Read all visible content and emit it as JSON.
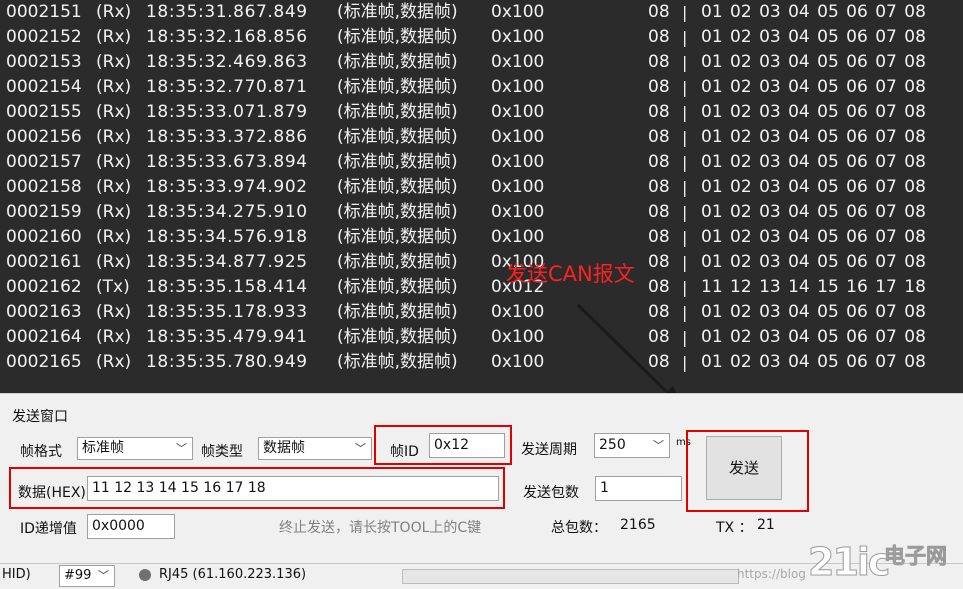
{
  "log": {
    "rows": [
      {
        "seq": "0002151",
        "dir": "(Rx)",
        "time": "18:35:31.867.849",
        "type": "(标准帧,数据帧)",
        "id": "0x100",
        "dlc": "08",
        "data": "01 02 03 04 05 06 07 08"
      },
      {
        "seq": "0002152",
        "dir": "(Rx)",
        "time": "18:35:32.168.856",
        "type": "(标准帧,数据帧)",
        "id": "0x100",
        "dlc": "08",
        "data": "01 02 03 04 05 06 07 08"
      },
      {
        "seq": "0002153",
        "dir": "(Rx)",
        "time": "18:35:32.469.863",
        "type": "(标准帧,数据帧)",
        "id": "0x100",
        "dlc": "08",
        "data": "01 02 03 04 05 06 07 08"
      },
      {
        "seq": "0002154",
        "dir": "(Rx)",
        "time": "18:35:32.770.871",
        "type": "(标准帧,数据帧)",
        "id": "0x100",
        "dlc": "08",
        "data": "01 02 03 04 05 06 07 08"
      },
      {
        "seq": "0002155",
        "dir": "(Rx)",
        "time": "18:35:33.071.879",
        "type": "(标准帧,数据帧)",
        "id": "0x100",
        "dlc": "08",
        "data": "01 02 03 04 05 06 07 08"
      },
      {
        "seq": "0002156",
        "dir": "(Rx)",
        "time": "18:35:33.372.886",
        "type": "(标准帧,数据帧)",
        "id": "0x100",
        "dlc": "08",
        "data": "01 02 03 04 05 06 07 08"
      },
      {
        "seq": "0002157",
        "dir": "(Rx)",
        "time": "18:35:33.673.894",
        "type": "(标准帧,数据帧)",
        "id": "0x100",
        "dlc": "08",
        "data": "01 02 03 04 05 06 07 08"
      },
      {
        "seq": "0002158",
        "dir": "(Rx)",
        "time": "18:35:33.974.902",
        "type": "(标准帧,数据帧)",
        "id": "0x100",
        "dlc": "08",
        "data": "01 02 03 04 05 06 07 08"
      },
      {
        "seq": "0002159",
        "dir": "(Rx)",
        "time": "18:35:34.275.910",
        "type": "(标准帧,数据帧)",
        "id": "0x100",
        "dlc": "08",
        "data": "01 02 03 04 05 06 07 08"
      },
      {
        "seq": "0002160",
        "dir": "(Rx)",
        "time": "18:35:34.576.918",
        "type": "(标准帧,数据帧)",
        "id": "0x100",
        "dlc": "08",
        "data": "01 02 03 04 05 06 07 08"
      },
      {
        "seq": "0002161",
        "dir": "(Rx)",
        "time": "18:35:34.877.925",
        "type": "(标准帧,数据帧)",
        "id": "0x100",
        "dlc": "08",
        "data": "01 02 03 04 05 06 07 08"
      },
      {
        "seq": "0002162",
        "dir": "(Tx)",
        "time": "18:35:35.158.414",
        "type": "(标准帧,数据帧)",
        "id": "0x012",
        "dlc": "08",
        "data": "11 12 13 14 15 16 17 18"
      },
      {
        "seq": "0002163",
        "dir": "(Rx)",
        "time": "18:35:35.178.933",
        "type": "(标准帧,数据帧)",
        "id": "0x100",
        "dlc": "08",
        "data": "01 02 03 04 05 06 07 08"
      },
      {
        "seq": "0002164",
        "dir": "(Rx)",
        "time": "18:35:35.479.941",
        "type": "(标准帧,数据帧)",
        "id": "0x100",
        "dlc": "08",
        "data": "01 02 03 04 05 06 07 08"
      },
      {
        "seq": "0002165",
        "dir": "(Rx)",
        "time": "18:35:35.780.949",
        "type": "(标准帧,数据帧)",
        "id": "0x100",
        "dlc": "08",
        "data": "01 02 03 04 05 06 07 08"
      }
    ],
    "separator": "|"
  },
  "annotation": {
    "text": "发送CAN报文",
    "color": "#ff2020"
  },
  "send_window": {
    "title": "发送窗口",
    "frame_format_label": "帧格式",
    "frame_format_value": "标准帧",
    "frame_type_label": "帧类型",
    "frame_type_value": "数据帧",
    "frame_id_label": "帧ID",
    "frame_id_value": "0x12",
    "period_label": "发送周期",
    "period_value": "250",
    "period_unit": "ms",
    "send_button": "发送",
    "data_label": "数据(HEX)",
    "data_value": "11 12 13 14 15 16 17 18",
    "packet_count_label": "发送包数",
    "packet_count_value": "1",
    "id_increment_label": "ID递增值",
    "id_increment_value": "0x0000",
    "hint": "终止发送，请长按TOOL上的C键",
    "total_label": "总包数：",
    "total_value": "2165",
    "tx_label": "TX ：",
    "tx_value": "21"
  },
  "status_bar": {
    "hid": "HID)",
    "port_value": "#99",
    "connection": "RJ45 (61.160.223.136)",
    "url": "https://blog"
  },
  "watermark": {
    "logo": "21ic",
    "cn": "电子网"
  },
  "colors": {
    "log_bg": "#2b2b2b",
    "highlight": "#e00000",
    "panel_bg": "#f0f0f0"
  }
}
